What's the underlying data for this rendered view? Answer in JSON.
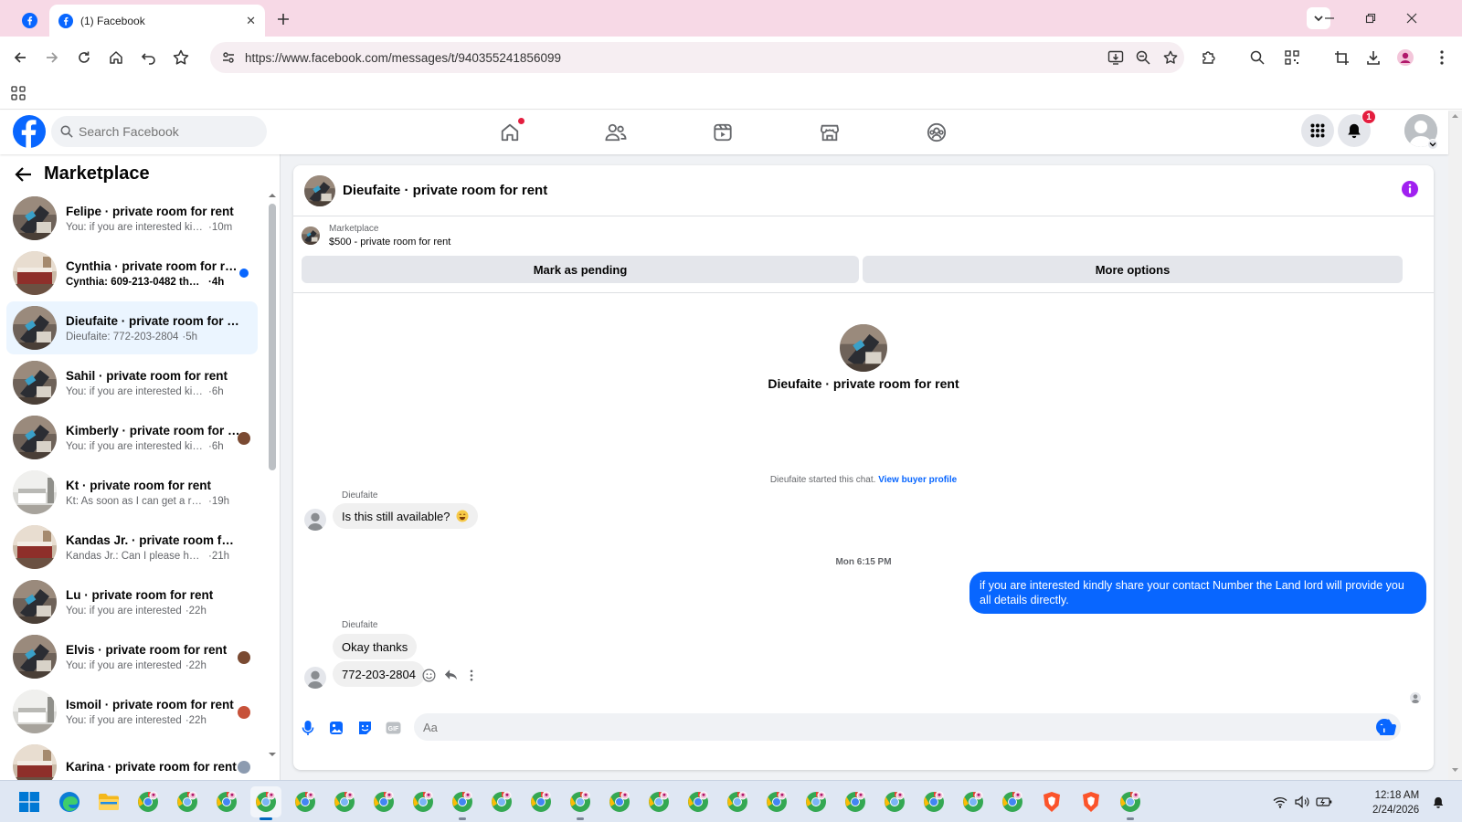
{
  "browser": {
    "tabs": [
      {
        "title": "",
        "pinned": true,
        "icon": "facebook-icon"
      },
      {
        "title": "(1) Facebook",
        "icon": "facebook-icon",
        "active": true
      }
    ],
    "url": "https://www.facebook.com/messages/t/940355241856099"
  },
  "fb": {
    "search_placeholder": "Search Facebook",
    "notification_count": "1"
  },
  "sidebar": {
    "title": "Marketplace",
    "conversations": [
      {
        "name": "Felipe · private room for rent",
        "preview": "You: if you are interested kindly ...",
        "time": "10m",
        "indicator": "none",
        "photo": "room"
      },
      {
        "name": "Cynthia · private room for rent",
        "preview": "Cynthia: 609-213-0482 thank y...",
        "time": "4h",
        "indicator": "unread",
        "photo": "bedroom"
      },
      {
        "name": "Dieufaite · private room for rent",
        "preview": "Dieufaite: 772-203-2804",
        "time": "5h",
        "indicator": "none",
        "photo": "room",
        "active": true
      },
      {
        "name": "Sahil · private room for rent",
        "preview": "You: if you are interested kindly sh...",
        "time": "6h",
        "indicator": "none",
        "photo": "room"
      },
      {
        "name": "Kimberly · private room for r...",
        "preview": "You: if you are interested kindly ...",
        "time": "6h",
        "indicator": "seen",
        "photo": "room"
      },
      {
        "name": "Kt · private room for rent",
        "preview": "Kt: As soon as I can get a room",
        "time": "19h",
        "indicator": "none",
        "photo": "white"
      },
      {
        "name": "Kandas Jr. · private room for rent",
        "preview": "Kandas Jr.: Can I please have an a...",
        "time": "21h",
        "indicator": "none",
        "photo": "bedroom"
      },
      {
        "name": "Lu · private room for rent",
        "preview": "You: if you are interested",
        "time": "22h",
        "indicator": "none",
        "photo": "room"
      },
      {
        "name": "Elvis · private room for rent",
        "preview": "You: if you are interested",
        "time": "22h",
        "indicator": "seen",
        "photo": "room"
      },
      {
        "name": "Ismoil · private room for rent",
        "preview": "You: if you are interested",
        "time": "22h",
        "indicator": "seen",
        "photo": "white"
      },
      {
        "name": "Karina · private room for rent",
        "preview": "",
        "time": "",
        "indicator": "seen",
        "photo": "bedroom"
      }
    ]
  },
  "chat": {
    "title": "Dieufaite · private room for rent",
    "listing_label": "Marketplace",
    "listing_title": "$500 - private room for rent",
    "mark_pending": "Mark as pending",
    "more_options": "More options",
    "intro_name": "Dieufaite · private room for rent",
    "started_text": "Dieufaite started this chat.",
    "view_buyer": "View buyer profile",
    "sender_1": "Dieufaite",
    "msg_1": "Is this still available?",
    "time_divider": "Mon 6:15 PM",
    "msg_out": "if you are interested kindly share your contact Number the Land lord will provide you all details directly.",
    "sender_2": "Dieufaite",
    "msg_2": "Okay thanks",
    "msg_3": "772-203-2804",
    "input_placeholder": "Aa"
  },
  "taskbar": {
    "time": "12:18 AM",
    "date": "2/24/2026"
  },
  "colors": {
    "fb_blue": "#0866ff",
    "tab_strip": "#f7d9e6",
    "active_conversation": "#ebf5ff",
    "info_purple": "#a020f0"
  }
}
